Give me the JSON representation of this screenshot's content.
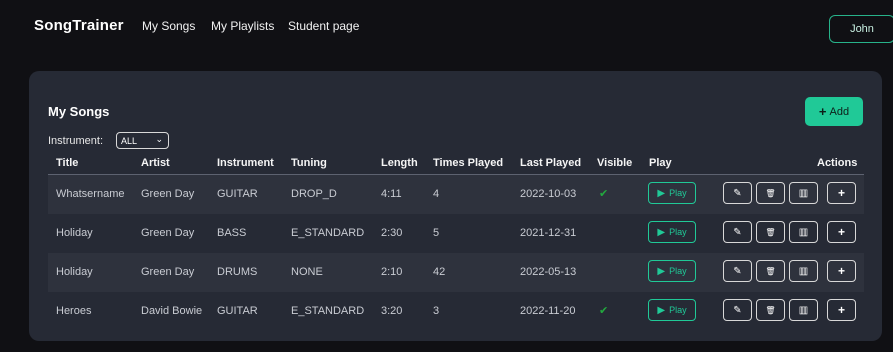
{
  "navbar": {
    "brand": "SongTrainer",
    "links": [
      "My Songs",
      "My Playlists",
      "Student page"
    ],
    "user": "John"
  },
  "card": {
    "title": "My Songs",
    "add_label": "Add",
    "instrument_label": "Instrument:",
    "instrument_selected": "ALL"
  },
  "columns": [
    "Title",
    "Artist",
    "Instrument",
    "Tuning",
    "Length",
    "Times Played",
    "Last Played",
    "Visible",
    "Play",
    "Actions"
  ],
  "play_label": "Play",
  "rows": [
    {
      "title": "Whatsername",
      "artist": "Green Day",
      "instrument": "GUITAR",
      "tuning": "DROP_D",
      "length": "4:11",
      "times_played": "4",
      "last_played": "2022-10-03",
      "visible": true
    },
    {
      "title": "Holiday",
      "artist": "Green Day",
      "instrument": "BASS",
      "tuning": "E_STANDARD",
      "length": "2:30",
      "times_played": "5",
      "last_played": "2021-12-31",
      "visible": false
    },
    {
      "title": "Holiday",
      "artist": "Green Day",
      "instrument": "DRUMS",
      "tuning": "NONE",
      "length": "2:10",
      "times_played": "42",
      "last_played": "2022-05-13",
      "visible": false
    },
    {
      "title": "Heroes",
      "artist": "David Bowie",
      "instrument": "GUITAR",
      "tuning": "E_STANDARD",
      "length": "3:20",
      "times_played": "3",
      "last_played": "2022-11-20",
      "visible": true
    }
  ],
  "icons": {
    "check": "check-icon",
    "play": "play-icon",
    "actions": [
      "pencil-icon",
      "trash-icon",
      "chart-icon",
      "plus-icon"
    ]
  },
  "colors": {
    "accent": "#20c997",
    "page_bg": "#101014",
    "card_bg": "#262a35",
    "visible_check": "#22a93e"
  }
}
